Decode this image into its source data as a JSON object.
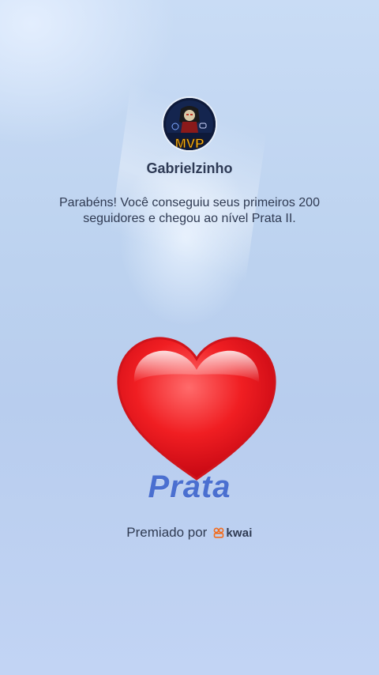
{
  "profile": {
    "username": "Gabrielzinho",
    "avatar_text": "MVP"
  },
  "message": "Parabéns! Você conseguiu seus primeiros 200 seguidores e chegou ao nível Prata II.",
  "badge": {
    "icon": "heart-icon",
    "tier_label": "Prata"
  },
  "footer": {
    "awarded_by": "Premiado por",
    "brand": "kwai",
    "brand_icon": "kwai-icon",
    "brand_color": "#f26b1d"
  },
  "colors": {
    "background": "#bcd2ef",
    "heart": "#e8141f",
    "tier_text": "#4a6fd0"
  }
}
